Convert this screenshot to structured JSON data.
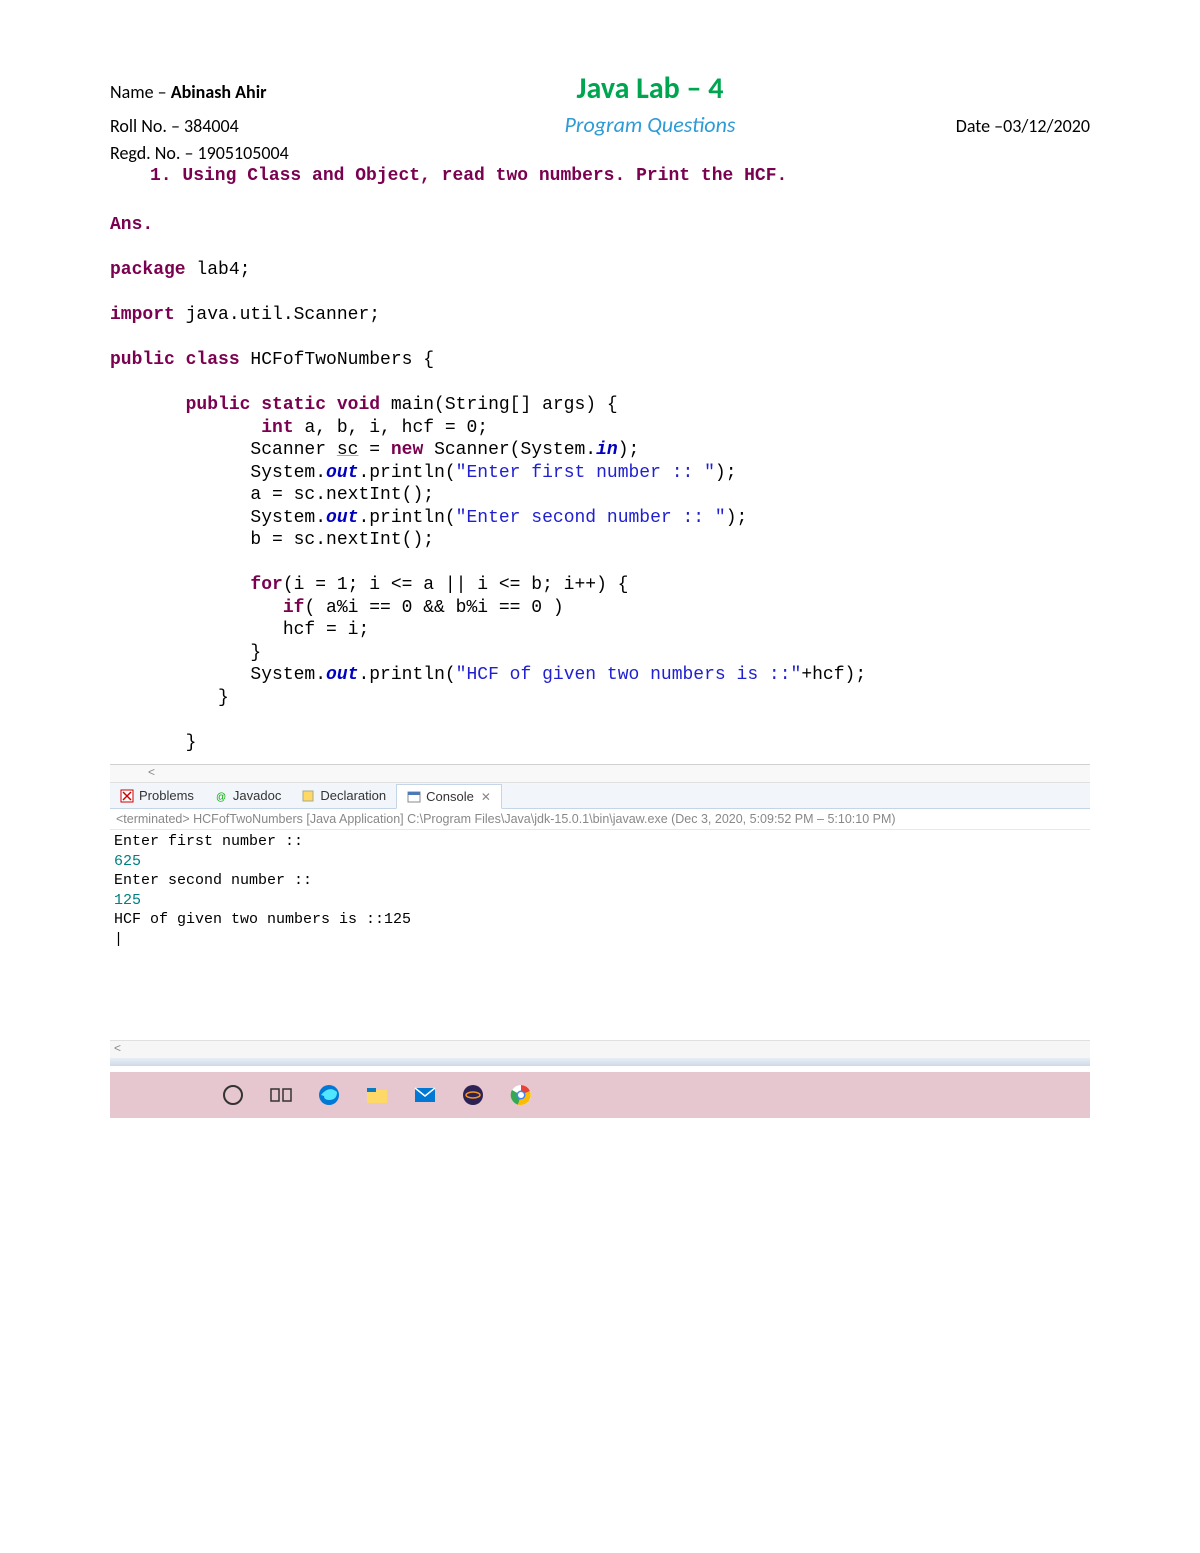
{
  "header": {
    "name_label": "Name – ",
    "name_value": "Abinash Ahir",
    "title": "Java Lab – 4",
    "roll_label": "Roll No. – 384004",
    "subtitle": "Program Questions",
    "date_label": "Date –03/12/2020",
    "regd_label": "Regd. No. – 1905105004"
  },
  "question": "1. Using Class and Object, read two numbers. Print the HCF.",
  "code": {
    "ans": "Ans.",
    "l1a": "package",
    "l1b": " lab4;",
    "l2a": "import",
    "l2b": " java.util.Scanner;",
    "l3a": "public class",
    "l3b": " HCFofTwoNumbers {",
    "l4a": "       public static void",
    "l4b": " main(String[] args) {",
    "l5a": "              int",
    "l5b": " a, b, i, hcf = 0;",
    "l6a": "             Scanner ",
    "l6sc": "sc",
    "l6b": " = ",
    "l6new": "new",
    "l6c": " Scanner(System.",
    "l6in": "in",
    "l6d": ");",
    "l7a": "             System.",
    "l7out": "out",
    "l7b": ".println(",
    "l7s": "\"Enter first number :: \"",
    "l7c": ");",
    "l8": "             a = sc.nextInt();",
    "l9a": "             System.",
    "l9out": "out",
    "l9b": ".println(",
    "l9s": "\"Enter second number :: \"",
    "l9c": ");",
    "l10": "             b = sc.nextInt();",
    "l11a": "             for",
    "l11b": "(i = 1; i <= a || i <= b; i++) {",
    "l12a": "                if",
    "l12b": "( a%i == 0 && b%i == 0 )",
    "l13": "                hcf = i;",
    "l14": "             }",
    "l15a": "             System.",
    "l15out": "out",
    "l15b": ".println(",
    "l15s": "\"HCF of given two numbers is ::\"",
    "l15c": "+hcf);",
    "l16": "          }",
    "l17": "       }"
  },
  "ide": {
    "scroll_left": "<",
    "tabs": {
      "problems": "Problems",
      "javadoc": "Javadoc",
      "declaration": "Declaration",
      "console": "Console"
    },
    "terminated": "<terminated> HCFofTwoNumbers [Java Application] C:\\Program Files\\Java\\jdk-15.0.1\\bin\\javaw.exe  (Dec 3, 2020, 5:09:52 PM – 5:10:10 PM)",
    "console_lines": {
      "l1": "Enter first number :: ",
      "l2": "625",
      "l3": "Enter second number :: ",
      "l4": "125",
      "l5": "HCF of given two numbers is ::125",
      "l6": "|"
    }
  },
  "taskbar": {
    "icons": [
      "cortana-icon",
      "taskview-icon",
      "edge-icon",
      "explorer-icon",
      "mail-icon",
      "eclipse-icon",
      "chrome-icon"
    ]
  }
}
